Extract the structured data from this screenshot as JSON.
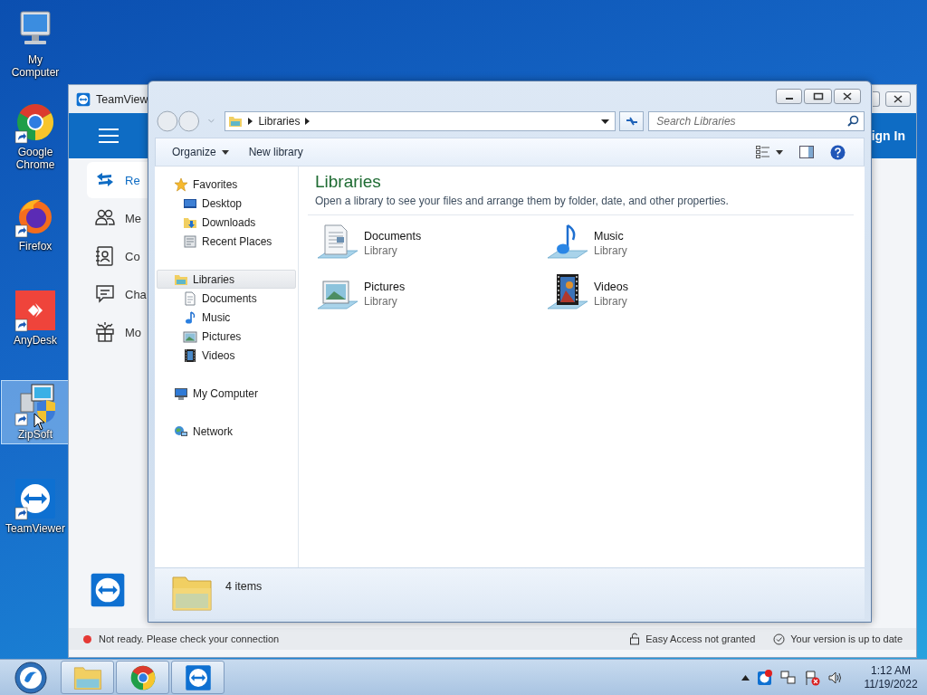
{
  "desktop_icons": [
    {
      "label": "My Computer",
      "kind": "computer",
      "shortcut": false,
      "selected": false
    },
    {
      "label": "Google Chrome",
      "kind": "chrome",
      "shortcut": true,
      "selected": false
    },
    {
      "label": "Firefox",
      "kind": "firefox",
      "shortcut": true,
      "selected": false
    },
    {
      "label": "AnyDesk",
      "kind": "anydesk",
      "shortcut": true,
      "selected": false
    },
    {
      "label": "ZipSoft",
      "kind": "installer",
      "shortcut": true,
      "selected": true
    },
    {
      "label": "TeamViewer",
      "kind": "teamviewer",
      "shortcut": true,
      "selected": false
    }
  ],
  "teamviewer": {
    "title": "TeamView",
    "header_text": "ign In",
    "nav": [
      {
        "label": "Re",
        "kind": "remote",
        "selected": true
      },
      {
        "label": "Me",
        "kind": "meeting",
        "selected": false
      },
      {
        "label": "Co",
        "kind": "contacts",
        "selected": false
      },
      {
        "label": "Cha",
        "kind": "chat",
        "selected": false
      },
      {
        "label": "Mo",
        "kind": "gift",
        "selected": false
      }
    ],
    "status": {
      "ready": false,
      "message": "Not ready. Please check your connection",
      "easy_access": "Easy Access not granted",
      "version": "Your version is up to date"
    }
  },
  "explorer": {
    "breadcrumb": [
      "Libraries"
    ],
    "search": {
      "placeholder": "Search Libraries"
    },
    "commands": [
      {
        "label": "Organize",
        "menu": true
      },
      {
        "label": "New library",
        "menu": false
      }
    ],
    "nav_pane": [
      {
        "label": "Favorites",
        "kind": "star",
        "selected": false,
        "children": [
          {
            "label": "Desktop",
            "kind": "desktop",
            "selected": false
          },
          {
            "label": "Downloads",
            "kind": "downloads",
            "selected": false
          },
          {
            "label": "Recent Places",
            "kind": "recent",
            "selected": false
          }
        ]
      },
      {
        "label": "Libraries",
        "kind": "library",
        "selected": true,
        "children": [
          {
            "label": "Documents",
            "kind": "document",
            "selected": false
          },
          {
            "label": "Music",
            "kind": "music",
            "selected": false
          },
          {
            "label": "Pictures",
            "kind": "pictures",
            "selected": false
          },
          {
            "label": "Videos",
            "kind": "videos",
            "selected": false
          }
        ]
      },
      {
        "label": "My Computer",
        "kind": "computer",
        "selected": false
      },
      {
        "label": "Network",
        "kind": "network",
        "selected": false
      }
    ],
    "heading": "Libraries",
    "description": "Open a library to see your files and arrange them by folder, date, and other properties.",
    "libraries": [
      {
        "name": "Documents",
        "type": "Library",
        "kind": "document"
      },
      {
        "name": "Music",
        "type": "Library",
        "kind": "music"
      },
      {
        "name": "Pictures",
        "type": "Library",
        "kind": "pictures"
      },
      {
        "name": "Videos",
        "type": "Library",
        "kind": "videos"
      }
    ],
    "status": "4 items"
  },
  "taskbar": {
    "time": "1:12 AM",
    "date": "11/19/2022"
  }
}
